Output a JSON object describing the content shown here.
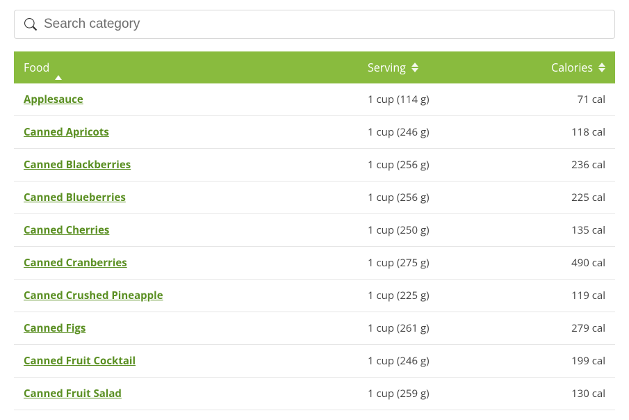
{
  "search": {
    "placeholder": "Search category",
    "value": ""
  },
  "table": {
    "columns": {
      "food": "Food",
      "serving": "Serving",
      "calories": "Calories"
    },
    "rows": [
      {
        "food": "Applesauce",
        "serving": "1 cup (114 g)",
        "calories": "71 cal"
      },
      {
        "food": "Canned Apricots",
        "serving": "1 cup (246 g)",
        "calories": "118 cal"
      },
      {
        "food": "Canned Blackberries",
        "serving": "1 cup (256 g)",
        "calories": "236 cal"
      },
      {
        "food": "Canned Blueberries",
        "serving": "1 cup (256 g)",
        "calories": "225 cal"
      },
      {
        "food": "Canned Cherries",
        "serving": "1 cup (250 g)",
        "calories": "135 cal"
      },
      {
        "food": "Canned Cranberries",
        "serving": "1 cup (275 g)",
        "calories": "490 cal"
      },
      {
        "food": "Canned Crushed Pineapple",
        "serving": "1 cup (225 g)",
        "calories": "119 cal"
      },
      {
        "food": "Canned Figs",
        "serving": "1 cup (261 g)",
        "calories": "279 cal"
      },
      {
        "food": "Canned Fruit Cocktail",
        "serving": "1 cup (246 g)",
        "calories": "199 cal"
      },
      {
        "food": "Canned Fruit Salad",
        "serving": "1 cup (259 g)",
        "calories": "130 cal"
      }
    ]
  }
}
